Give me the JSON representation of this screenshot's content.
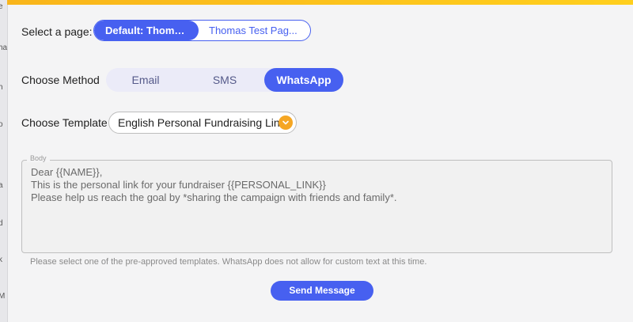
{
  "left_edge_fragments": [
    "e",
    "ha",
    "h",
    "o",
    "a",
    "d",
    "k",
    "M"
  ],
  "page_select": {
    "label": "Select a page:",
    "options": [
      "Default: Thomas ...",
      "Thomas Test Pag..."
    ],
    "selected": "Default: Thomas ..."
  },
  "method": {
    "label": "Choose Method",
    "tabs": [
      "Email",
      "SMS",
      "WhatsApp"
    ],
    "selected": "WhatsApp"
  },
  "template": {
    "label": "Choose Template",
    "value": "English Personal Fundraising Link"
  },
  "body": {
    "legend": "Body",
    "lines": [
      "Dear {{NAME}},",
      "This is the personal link for your fundraiser {{PERSONAL_LINK}}",
      "Please help us reach the goal by *sharing the campaign with friends and family*."
    ]
  },
  "help_text": "Please select one of the pre-approved templates. WhatsApp does not allow for custom text at this time.",
  "send_button": "Send Message",
  "colors": {
    "accent": "#4760f0",
    "top_bar": "#ffc21a",
    "chevron": "#f5a623"
  },
  "icons": {
    "template_dropdown": "chevron-down-icon"
  }
}
